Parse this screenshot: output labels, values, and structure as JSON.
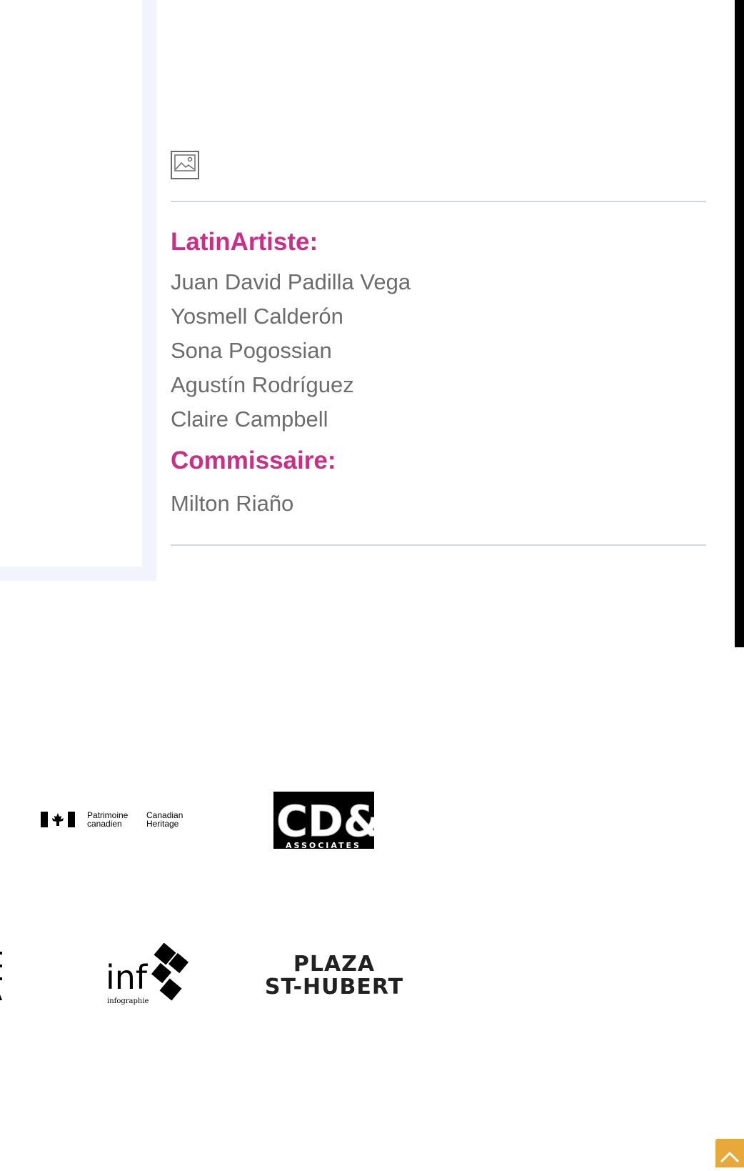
{
  "credits": {
    "artists_heading": "LatinArtiste:",
    "artists": [
      "Juan David Padilla Vega",
      "Yosmell Calderón",
      "Sona Pogossian",
      "Agustín Rodríguez",
      "Claire Campbell"
    ],
    "curator_heading": "Commissaire:",
    "curators": [
      "Milton Riaño"
    ]
  },
  "sponsors": {
    "heritage": {
      "line_fr_1": "Patrimoine",
      "line_fr_2": "canadien",
      "line_en_1": "Canadian",
      "line_en_2": "Heritage"
    },
    "cdi": {
      "mark": "CD&I",
      "subtitle": "ASSOCIATES"
    },
    "info": {
      "mark": "inf",
      "subtitle": "infographie"
    },
    "plaza": {
      "line1": "PLAZA",
      "line2": "ST-HUBERT"
    }
  },
  "icons": {
    "image_placeholder": "broken-image-icon",
    "back_to_top": "chevron-up-icon",
    "flag": "canada-flag-icon"
  },
  "colors": {
    "heading": "#cc2e85",
    "body_text": "#6c6c6c",
    "panel_tint": "#f1f4fd",
    "divider": "#cfd8e0",
    "back_to_top": "#e7a93a"
  }
}
